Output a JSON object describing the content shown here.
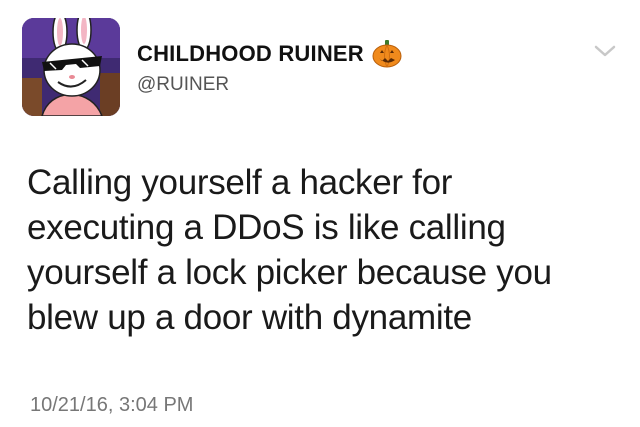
{
  "tweet": {
    "display_name": "CHILDHOOD RUINER",
    "name_emoji": "jack-o-lantern-icon",
    "handle": "@RUINER",
    "text_lines": [
      "Calling yourself a hacker for",
      "executing a DDoS is like calling",
      "yourself a lock picker because you",
      "blew up a door with dynamite"
    ],
    "timestamp": "10/21/16, 3:04 PM",
    "menu_icon": "chevron-down-icon"
  },
  "colors": {
    "name": "#111111",
    "handle": "#555555",
    "text": "#1a1a1a",
    "timestamp": "#777777",
    "chevron": "#c8c8c8",
    "pumpkin": "#f08a1c"
  }
}
